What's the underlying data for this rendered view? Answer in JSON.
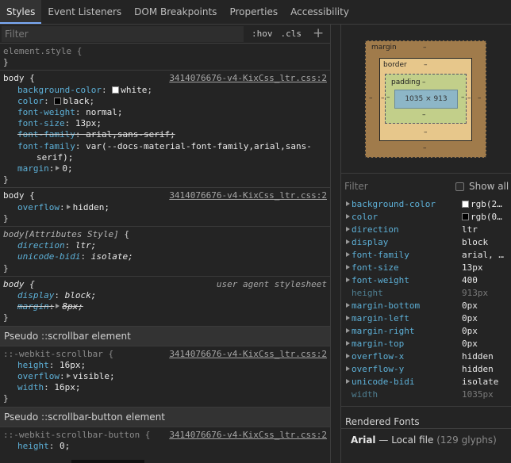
{
  "tabs": [
    {
      "label": "Styles",
      "active": true
    },
    {
      "label": "Event Listeners"
    },
    {
      "label": "DOM Breakpoints"
    },
    {
      "label": "Properties"
    },
    {
      "label": "Accessibility"
    }
  ],
  "styles_filter": {
    "placeholder": "Filter",
    "hov": ":hov",
    "cls": ".cls",
    "plus": "+"
  },
  "rules": {
    "element_style": {
      "selector": "element.style {",
      "close": "}"
    },
    "body1": {
      "selector": "body {",
      "source": "3414076676-v4-KixCss_ltr.css:2",
      "d1": {
        "name": "background-color",
        "value": "white",
        "swatch": "#ffffff"
      },
      "d2": {
        "name": "color",
        "value": "black",
        "swatch": "#000000"
      },
      "d3": {
        "name": "font-weight",
        "value": "normal;"
      },
      "d4": {
        "name": "font-size",
        "value": "13px;"
      },
      "d5": {
        "name": "font-family",
        "value": "arial,sans-serif;"
      },
      "d6": {
        "name": "font-family",
        "value": "var(--docs-material-font-family,arial,sans-",
        "cont": "serif);"
      },
      "d7": {
        "name": "margin",
        "value": "0;"
      },
      "close": "}"
    },
    "body2": {
      "selector": "body {",
      "source": "3414076676-v4-KixCss_ltr.css:2",
      "d1": {
        "name": "overflow",
        "value": "hidden;"
      },
      "close": "}"
    },
    "attr_style": {
      "selector": "body[Attributes Style]",
      "brace": "{",
      "d1": {
        "name": "direction",
        "value": "ltr;"
      },
      "d2": {
        "name": "unicode-bidi",
        "value": "isolate;"
      },
      "close": "}"
    },
    "ua": {
      "selector": "body {",
      "source": "user agent stylesheet",
      "d1": {
        "name": "display",
        "value": "block;"
      },
      "d2": {
        "name": "margin",
        "value": "8px;"
      },
      "close": "}"
    },
    "pseudo_scrollbar": {
      "header": "Pseudo ::scrollbar element",
      "selector": "::-webkit-scrollbar {",
      "source": "3414076676-v4-KixCss_ltr.css:2",
      "d1": {
        "name": "height",
        "value": "16px;"
      },
      "d2": {
        "name": "overflow",
        "value": "visible;"
      },
      "d3": {
        "name": "width",
        "value": "16px;"
      },
      "close": "}"
    },
    "pseudo_scrollbar_button": {
      "header": "Pseudo ::scrollbar-button element",
      "selector": "::-webkit-scrollbar-button {",
      "source": "3414076676-v4-KixCss_ltr.css:2",
      "d1": {
        "name": "height",
        "value": "0;"
      }
    }
  },
  "separators": {
    "colon": ":",
    "semicolon": ";"
  },
  "box_model": {
    "margin_label": "margin",
    "border_label": "border",
    "padding_label": "padding",
    "content": "1035 × 913",
    "dash": "–"
  },
  "computed_filter": {
    "placeholder": "Filter",
    "show_all": "Show all"
  },
  "computed": [
    {
      "name": "background-color",
      "value": "rgb(2…",
      "swatch": "#ffffff",
      "expandable": true
    },
    {
      "name": "color",
      "value": "rgb(0…",
      "swatch": "#000000",
      "expandable": true
    },
    {
      "name": "direction",
      "value": "ltr",
      "expandable": true
    },
    {
      "name": "display",
      "value": "block",
      "expandable": true
    },
    {
      "name": "font-family",
      "value": "arial, …",
      "expandable": true
    },
    {
      "name": "font-size",
      "value": "13px",
      "expandable": true
    },
    {
      "name": "font-weight",
      "value": "400",
      "expandable": true
    },
    {
      "name": "height",
      "value": "913px",
      "expandable": false
    },
    {
      "name": "margin-bottom",
      "value": "0px",
      "expandable": true
    },
    {
      "name": "margin-left",
      "value": "0px",
      "expandable": true
    },
    {
      "name": "margin-right",
      "value": "0px",
      "expandable": true
    },
    {
      "name": "margin-top",
      "value": "0px",
      "expandable": true
    },
    {
      "name": "overflow-x",
      "value": "hidden",
      "expandable": true
    },
    {
      "name": "overflow-y",
      "value": "hidden",
      "expandable": true
    },
    {
      "name": "unicode-bidi",
      "value": "isolate",
      "expandable": true
    },
    {
      "name": "width",
      "value": "1035px",
      "expandable": false
    }
  ],
  "rendered_fonts": {
    "title": "Rendered Fonts",
    "font": "Arial",
    "dash": "—",
    "source": "Local file",
    "glyphs": "(129 glyphs)"
  },
  "colors": {
    "accent": "#7cacf8",
    "property": "#5db0d7",
    "background": "#242424"
  }
}
